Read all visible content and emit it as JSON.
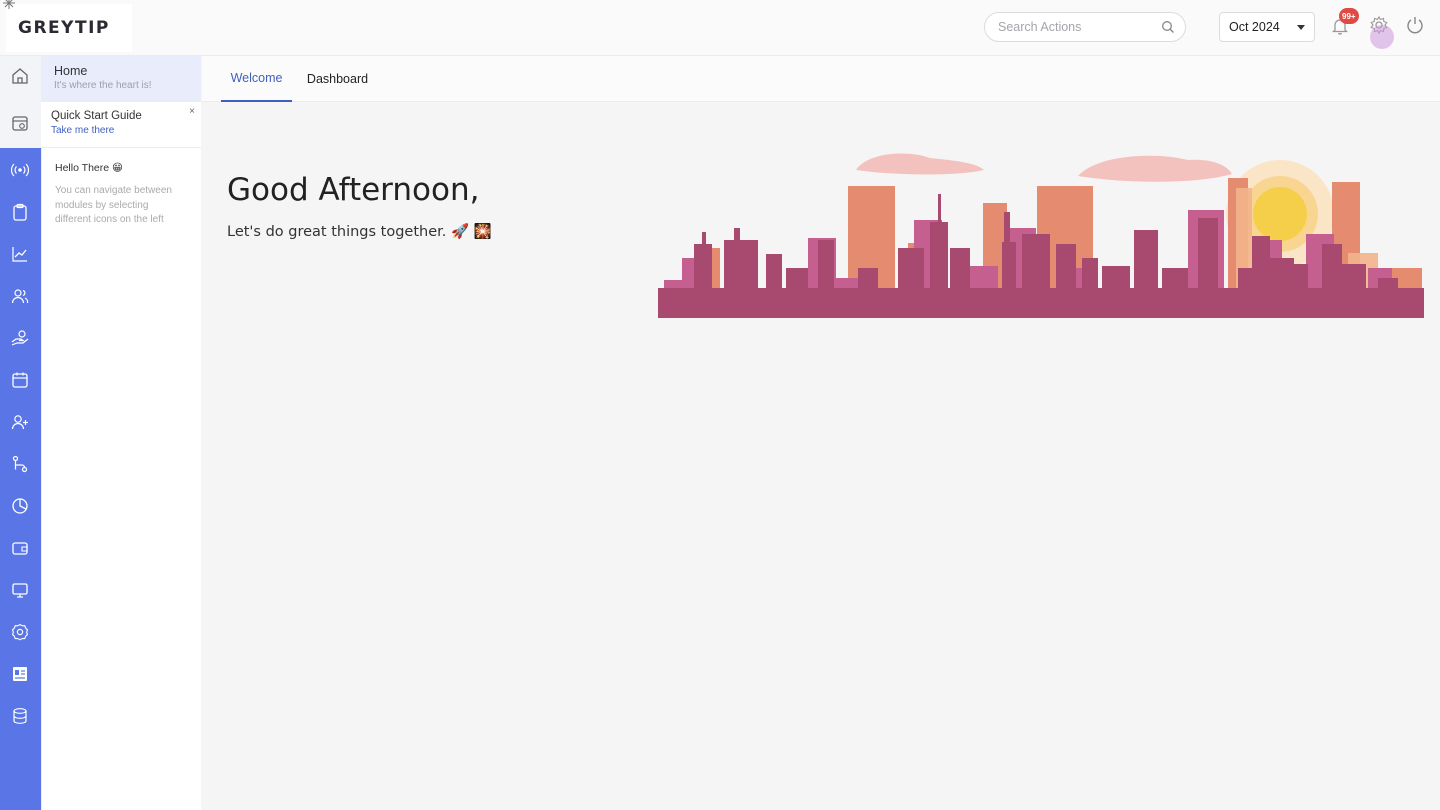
{
  "brand": {
    "logo_text": "GREYTIP"
  },
  "header": {
    "search_placeholder": "Search Actions",
    "period": "Oct 2024",
    "notification_badge": "99+"
  },
  "sidebar_nav": {
    "home": {
      "title": "Home",
      "subtitle": "It's where the heart is!"
    },
    "quick_start": {
      "title": "Quick Start Guide",
      "link": "Take me there",
      "close": "×"
    },
    "hello": {
      "title": "Hello There 😁",
      "body": "You can navigate between modules by selecting different icons on the left"
    }
  },
  "rail_icons": [
    "home-icon",
    "calendar-check-icon",
    "broadcast-icon",
    "clipboard-icon",
    "trend-chart-icon",
    "users-icon",
    "hand-coin-icon",
    "calendar-icon",
    "user-plus-icon",
    "workflow-icon",
    "pie-chart-icon",
    "wallet-icon",
    "monitor-icon",
    "settings-icon",
    "id-card-icon",
    "database-icon"
  ],
  "tabs": [
    {
      "label": "Welcome",
      "active": true
    },
    {
      "label": "Dashboard",
      "active": false
    }
  ],
  "welcome": {
    "greeting": "Good Afternoon,",
    "tagline": "Let's do great things together. 🚀 🎇"
  },
  "colors": {
    "rail": "#5a76e6",
    "accent": "#4060c0",
    "badge": "#e04a44",
    "skyline_dark": "#a8496f",
    "skyline_mid": "#c45f8f",
    "skyline_light": "#e58b70",
    "sun": "#f5cf4a"
  }
}
